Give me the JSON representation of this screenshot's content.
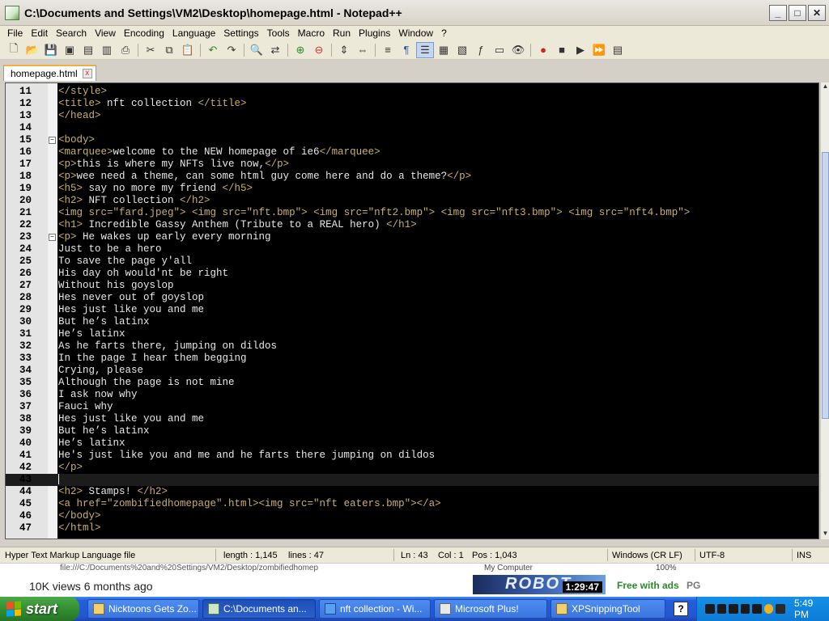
{
  "window": {
    "title": "C:\\Documents and Settings\\VM2\\Desktop\\homepage.html - Notepad++",
    "minimize": "_",
    "maximize": "□",
    "close": "✕"
  },
  "menu": [
    "File",
    "Edit",
    "Search",
    "View",
    "Encoding",
    "Language",
    "Settings",
    "Tools",
    "Macro",
    "Run",
    "Plugins",
    "Window",
    "?"
  ],
  "tab": {
    "label": "homepage.html",
    "close": "x"
  },
  "editor": {
    "lines": [
      {
        "n": "11",
        "code": "</style>"
      },
      {
        "n": "12",
        "code": "<title> nft collection </title>"
      },
      {
        "n": "13",
        "code": "</head>"
      },
      {
        "n": "14",
        "code": ""
      },
      {
        "n": "15",
        "code": "<body>"
      },
      {
        "n": "16",
        "code": "<marquee>welcome to the NEW homepage of ie6</marquee>"
      },
      {
        "n": "17",
        "code": "<p>this is where my NFTs live now,</p>"
      },
      {
        "n": "18",
        "code": "<p>wee need a theme, can some html guy come here and do a theme?</p>"
      },
      {
        "n": "19",
        "code": "<h5> say no more my friend </h5>"
      },
      {
        "n": "20",
        "code": "<h2> NFT collection </h2>"
      },
      {
        "n": "21",
        "code": "<img src=\"fard.jpeg\"> <img src=\"nft.bmp\"> <img src=\"nft2.bmp\"> <img src=\"nft3.bmp\"> <img src=\"nft4.bmp\">"
      },
      {
        "n": "22",
        "code": "<h1> Incredible Gassy Anthem (Tribute to a REAL hero) </h1>"
      },
      {
        "n": "23",
        "code": "<p> He wakes up early every morning"
      },
      {
        "n": "24",
        "code": "Just to be a hero"
      },
      {
        "n": "25",
        "code": "To save the page y'all"
      },
      {
        "n": "26",
        "code": "His day oh would'nt be right"
      },
      {
        "n": "27",
        "code": "Without his goyslop"
      },
      {
        "n": "28",
        "code": "Hes never out of goyslop"
      },
      {
        "n": "29",
        "code": "Hes just like you and me"
      },
      {
        "n": "30",
        "code": "But he’s latinx"
      },
      {
        "n": "31",
        "code": "He’s latinx"
      },
      {
        "n": "32",
        "code": "As he farts there, jumping on dildos"
      },
      {
        "n": "33",
        "code": "In the page I hear them begging"
      },
      {
        "n": "34",
        "code": "Crying, please"
      },
      {
        "n": "35",
        "code": "Although the page is not mine"
      },
      {
        "n": "36",
        "code": "I ask now why"
      },
      {
        "n": "37",
        "code": "Fauci why"
      },
      {
        "n": "38",
        "code": "Hes just like you and me"
      },
      {
        "n": "39",
        "code": "But he’s latinx"
      },
      {
        "n": "40",
        "code": "He’s latinx"
      },
      {
        "n": "41",
        "code": "He's just like you and me and he farts there jumping on dildos"
      },
      {
        "n": "42",
        "code": "</p>"
      },
      {
        "n": "43",
        "code": ""
      },
      {
        "n": "44",
        "code": "<h2> Stamps! </h2>"
      },
      {
        "n": "45",
        "code": "<a href=\"zombifiedhomepage\".html><img src=\"nft eaters.bmp\"></a>"
      },
      {
        "n": "46",
        "code": "</body>"
      },
      {
        "n": "47",
        "code": "</html>"
      }
    ],
    "current_line": "43",
    "fold_lines": [
      "15",
      "23"
    ]
  },
  "status": {
    "file_type": "Hyper Text Markup Language file",
    "length": "length : 1,145",
    "lines": "lines : 47",
    "ln": "Ln : 43",
    "col": "Col : 1",
    "pos": "Pos : 1,043",
    "eol": "Windows (CR LF)",
    "encoding": "UTF-8",
    "mode": "INS"
  },
  "overlay": {
    "url": "file:///C:/Documents%20and%20Settings/VM2/Desktop/zombifiedhomep",
    "views": "10K views  6 months ago",
    "my_computer": "My Computer",
    "zoom": "100%",
    "ad_time": "1:29:47",
    "free_with_ads": "Free with ads",
    "rating": "PG"
  },
  "taskbar": {
    "start": "start",
    "tasks": [
      {
        "label": "Nicktoons Gets Zo..."
      },
      {
        "label": "C:\\Documents an..."
      },
      {
        "label": "nft collection - Wi..."
      },
      {
        "label": "Microsoft Plus!"
      },
      {
        "label": "XPSnippingTool"
      }
    ],
    "help": "?",
    "clock": "5:49 PM"
  }
}
